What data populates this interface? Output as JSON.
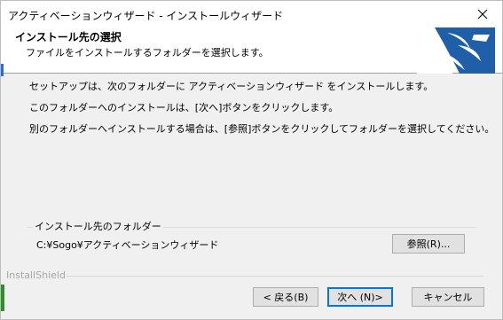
{
  "window": {
    "title": "アクティベーションウィザード - インストールウィザード"
  },
  "header": {
    "title": "インストール先の選択",
    "subtitle": "ファイルをインストールするフォルダーを選択します。"
  },
  "body": {
    "line1": "セットアップは、次のフォルダーに アクティベーションウィザード をインストールします。",
    "line2": "このフォルダーへのインストールは、[次へ]ボタンをクリックします。",
    "line3": "別のフォルダーへインストールする場合は、[参照]ボタンをクリックしてフォルダーを選択してください。"
  },
  "destination": {
    "group_label": "インストール先のフォルダー",
    "path": "C:¥Sogo¥アクティベーションウィザード",
    "browse_label": "参照(R)..."
  },
  "footer": {
    "brand": "InstallShield",
    "back_label": "< 戻る(B)",
    "next_label": "次へ (N)>",
    "cancel_label": "キャンセル"
  },
  "icons": {
    "close": "close-icon",
    "logo": "wizard-logo-icon"
  },
  "colors": {
    "accent_blue": "#0078d7",
    "logo_blue": "#1f5fa8",
    "window_bg": "#f0f0f0"
  }
}
